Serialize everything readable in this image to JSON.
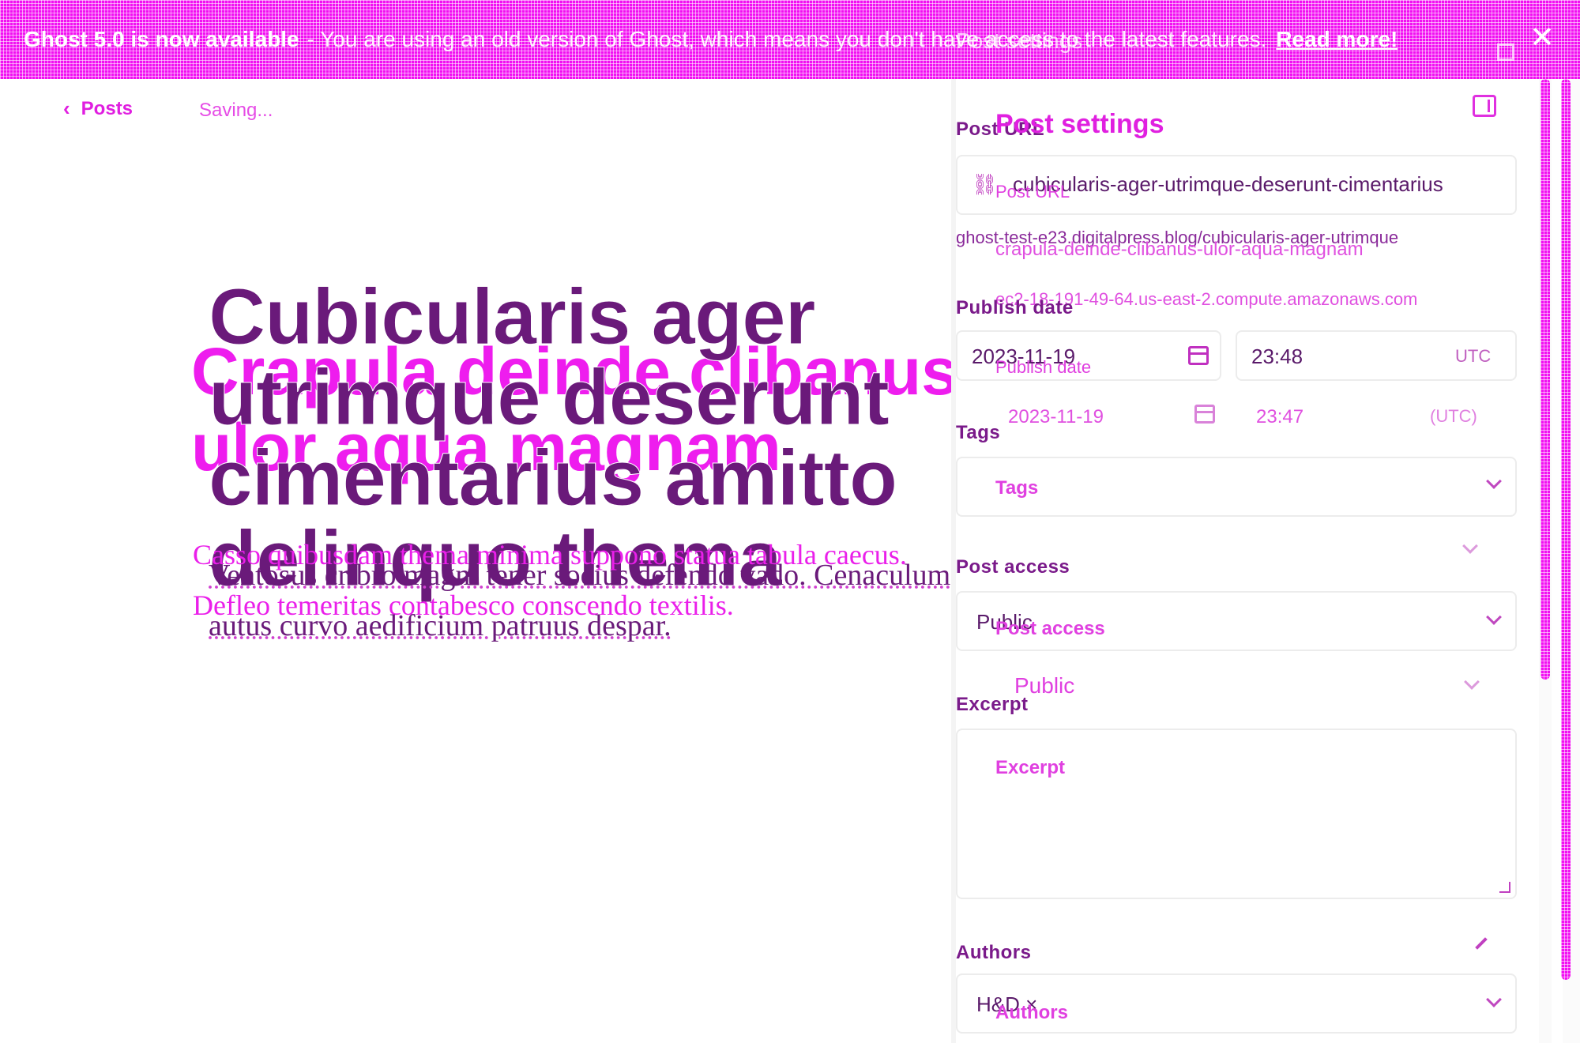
{
  "banner": {
    "strong": "Ghost 5.0 is now available",
    "message": "- You are using an old version of Ghost, which means you don't have access to the latest features.",
    "link": "Read more!",
    "close": "✕",
    "ghost_title": "Post settings"
  },
  "editor": {
    "back_label": "Posts",
    "status": "Saving...",
    "title_primary": "Cubicularis ager utrimque deserunt cimentarius amitto delinquo thema",
    "title_secondary": "Crapula deinde clibanus ulor aqua magnam",
    "body_primary": "Ventosus cribro magni tener socius defendo vado. Cenaculum autus curvo aedificium patruus despar.",
    "body_secondary": "Casso quibusdam thema minima suppono statua tabula caecus. Defleo temeritas contabesco conscendo textilis."
  },
  "panel": {
    "heading": "Post settings",
    "post_url_label": "Post URL",
    "post_url_value": "cubicularis-ager-utrimque-deserunt-cimentarius",
    "post_url_ghost": "crapula-deinde-clibanus-ulor-aqua-magnam",
    "post_url_hint": "ghost-test-e23.digitalpress.blog/cubicularis-ager-utrimque",
    "post_url_hint_ghost": "ec2-18-191-49-64.us-east-2.compute.amazonaws.com",
    "publish_date_label": "Publish date",
    "date_value": "2023-11-19",
    "time_value": "23:48",
    "timezone": "UTC",
    "date_value_ghost": "2023-11-19",
    "time_value_ghost": "23:47",
    "timezone_ghost": "(UTC)",
    "tags_label": "Tags",
    "tags_placeholder": "Tags",
    "access_label": "Post access",
    "access_value": "Public",
    "access_label_ghost": "Post access",
    "access_value_ghost": "Public",
    "excerpt_label": "Excerpt",
    "excerpt_placeholder": "Excerpt",
    "authors_label": "Authors",
    "authors_value": "H&D ×",
    "authors_ghost": "Authors"
  },
  "colors": {
    "accent": "#f20ff2",
    "dark_text": "#6a1a7a"
  }
}
